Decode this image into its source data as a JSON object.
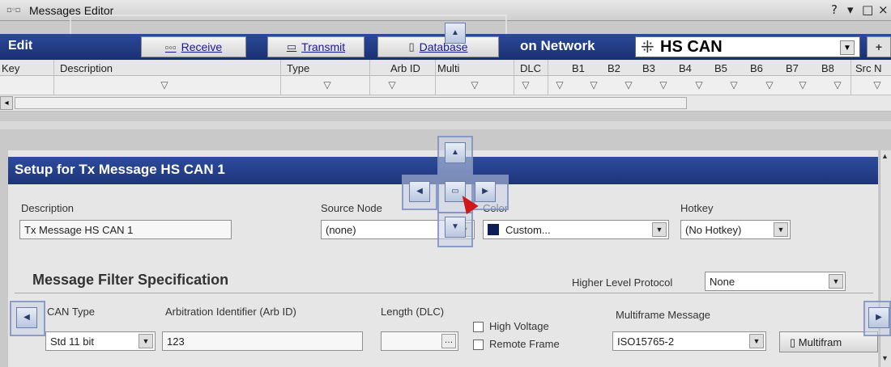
{
  "window": {
    "title": "Messages Editor",
    "controls": [
      "?",
      "▾",
      "□",
      "×"
    ]
  },
  "toolbar": {
    "edit_label": "Edit",
    "receive_label": "Receive",
    "transmit_label": "Transmit",
    "database_label": "Database",
    "network_label": "on Network",
    "network_value": "HS CAN",
    "add_label": "+"
  },
  "grid": {
    "columns": [
      "Key",
      "Description",
      "Type",
      "Arb ID",
      "Multi",
      "DLC",
      "B1",
      "B2",
      "B3",
      "B4",
      "B5",
      "B6",
      "B7",
      "B8",
      "Src N"
    ]
  },
  "setup": {
    "header": "Setup for Tx Message HS CAN 1",
    "description_label": "Description",
    "description_value": "Tx Message HS CAN 1",
    "source_node_label": "Source Node",
    "source_node_value": "(none)",
    "color_label": "Color",
    "color_value": "Custom...",
    "color_swatch": "#0f1f56",
    "hotkey_label": "Hotkey",
    "hotkey_value": "(No Hotkey)",
    "filter_title": "Message Filter Specification",
    "hlp_label": "Higher Level Protocol",
    "hlp_value": "None",
    "can_type_label": "CAN Type",
    "can_type_value": "Std 11 bit",
    "arb_id_label": "Arbitration Identifier (Arb ID)",
    "arb_id_value": "123",
    "length_label": "Length (DLC)",
    "length_value": "",
    "high_voltage_label": "High Voltage",
    "remote_frame_label": "Remote Frame",
    "multiframe_label": "Multiframe Message",
    "multiframe_value": "ISO15765-2",
    "multiframe_button": "Multifram"
  }
}
